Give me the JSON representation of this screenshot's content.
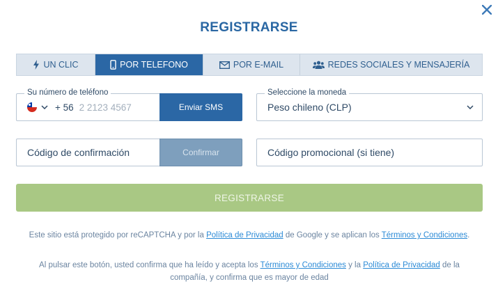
{
  "dialog": {
    "title": "REGISTRARSE",
    "close_icon": "close-icon"
  },
  "tabs": [
    {
      "label": "UN CLIC",
      "icon": "lightning-icon",
      "active": false
    },
    {
      "label": "POR TELEFONO",
      "icon": "phone-icon",
      "active": true
    },
    {
      "label": "POR E-MAIL",
      "icon": "envelope-icon",
      "active": false
    },
    {
      "label": "REDES SOCIALES Y MENSAJERÍA",
      "icon": "users-icon",
      "active": false
    }
  ],
  "phone": {
    "label": "Su número de teléfono",
    "country_flag": "chile-flag-icon",
    "dial_code": "+ 56",
    "placeholder": "2 2123 4567",
    "value": "",
    "send_sms_label": "Enviar SMS"
  },
  "currency": {
    "label": "Seleccione la moneda",
    "selected": "Peso chileno (CLP)"
  },
  "confirmation": {
    "placeholder": "Código de confirmación",
    "confirm_label": "Confirmar"
  },
  "promo": {
    "placeholder": "Código promocional (si tiene)"
  },
  "register_button": "REGISTRARSE",
  "recaptcha_notice": {
    "part1": "Este sitio está protegido por reCAPTCHA y por la ",
    "privacy_link": "Política de Privacidad",
    "part2": " de Google y se aplican los ",
    "terms_link": "Términos y Condiciones",
    "part3": "."
  },
  "consent_notice": {
    "part1": "Al pulsar este botón, usted confirma que ha leído y acepta los ",
    "terms_link": "Términos y Condiciones",
    "part2": " y la ",
    "privacy_link": "Política de Privacidad",
    "part3": " de la compañía, y confirma que es mayor de edad"
  },
  "colors": {
    "primary": "#2b67a5",
    "title": "#2a67a3",
    "tab_background": "#dde5ee",
    "register_disabled": "#a9c884",
    "confirm_disabled": "#7e9fbd",
    "link": "#2b8ad6"
  }
}
